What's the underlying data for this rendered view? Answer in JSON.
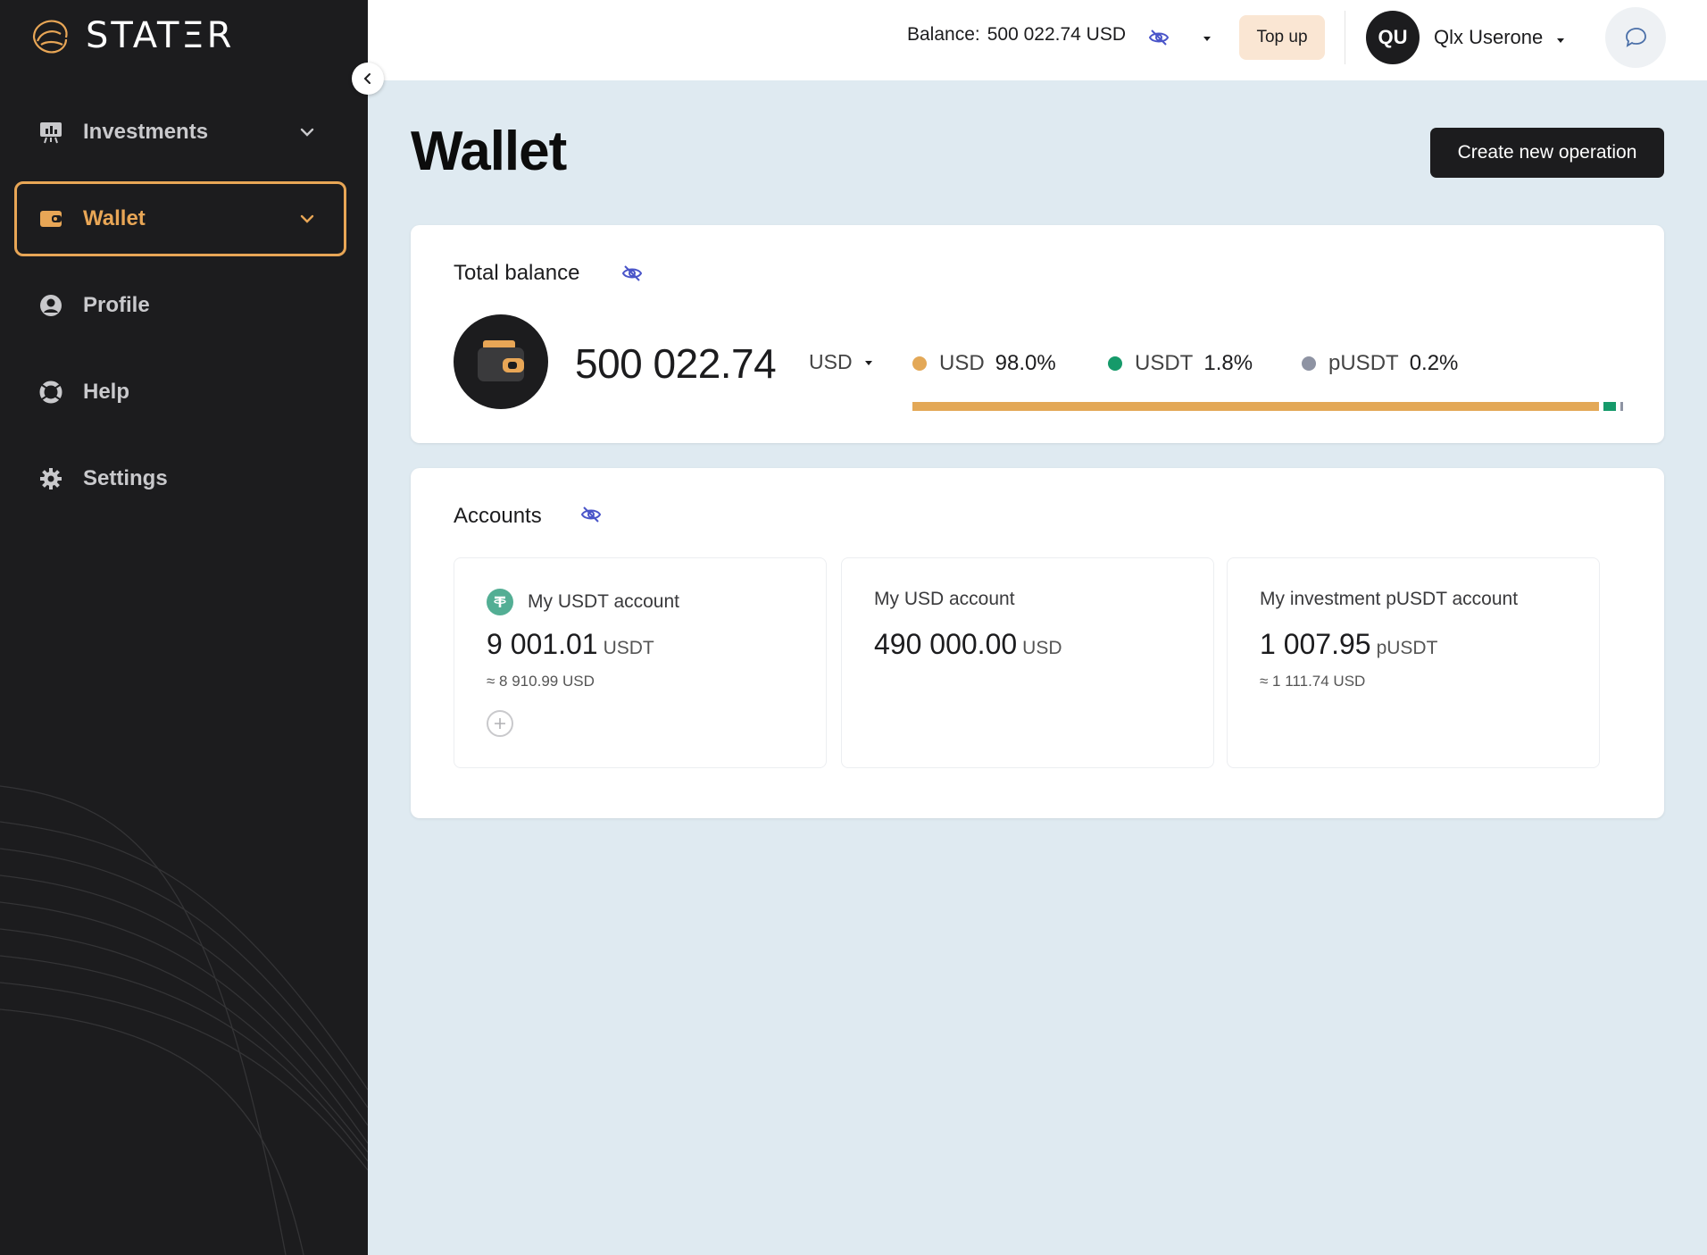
{
  "app": {
    "brand": "STATΞR"
  },
  "sidebar": {
    "items": [
      {
        "label": "Investments",
        "icon": "chart-board-icon",
        "active": false
      },
      {
        "label": "Wallet",
        "icon": "wallet-icon",
        "active": true
      },
      {
        "label": "Profile",
        "icon": "user-icon",
        "active": false
      },
      {
        "label": "Help",
        "icon": "lifebuoy-icon",
        "active": false
      },
      {
        "label": "Settings",
        "icon": "gear-icon",
        "active": false
      }
    ]
  },
  "topbar": {
    "balance_label": "Balance:",
    "balance_value": "500 022.74 USD",
    "topup_label": "Top up",
    "avatar_initials": "QU",
    "username": "Qlx Userone"
  },
  "page": {
    "title": "Wallet",
    "create_button": "Create new operation"
  },
  "total_balance": {
    "title": "Total balance",
    "amount": "500 022.74",
    "currency": "USD",
    "distribution": [
      {
        "name": "USD",
        "percent_label": "98.0%",
        "percent": 98.0,
        "color": "#e3a857"
      },
      {
        "name": "USDT",
        "percent_label": "1.8%",
        "percent": 1.8,
        "color": "#169a6a"
      },
      {
        "name": "pUSDT",
        "percent_label": "0.2%",
        "percent": 0.2,
        "color": "#8e93a3"
      }
    ]
  },
  "accounts": {
    "title": "Accounts",
    "items": [
      {
        "name": "My USDT account",
        "amount": "9 001.01",
        "unit": "USDT",
        "approx": "≈ 8 910.99 USD"
      },
      {
        "name": "My USD account",
        "amount": "490 000.00",
        "unit": "USD",
        "approx": ""
      },
      {
        "name": "My investment pUSDT account",
        "amount": "1 007.95",
        "unit": "pUSDT",
        "approx": "≈ 1 111.74 USD"
      }
    ]
  },
  "colors": {
    "accent": "#e8a656",
    "sidebar_bg": "#1c1c1e",
    "page_bg": "#dfeaf1",
    "eye_icon": "#4a55c9"
  }
}
